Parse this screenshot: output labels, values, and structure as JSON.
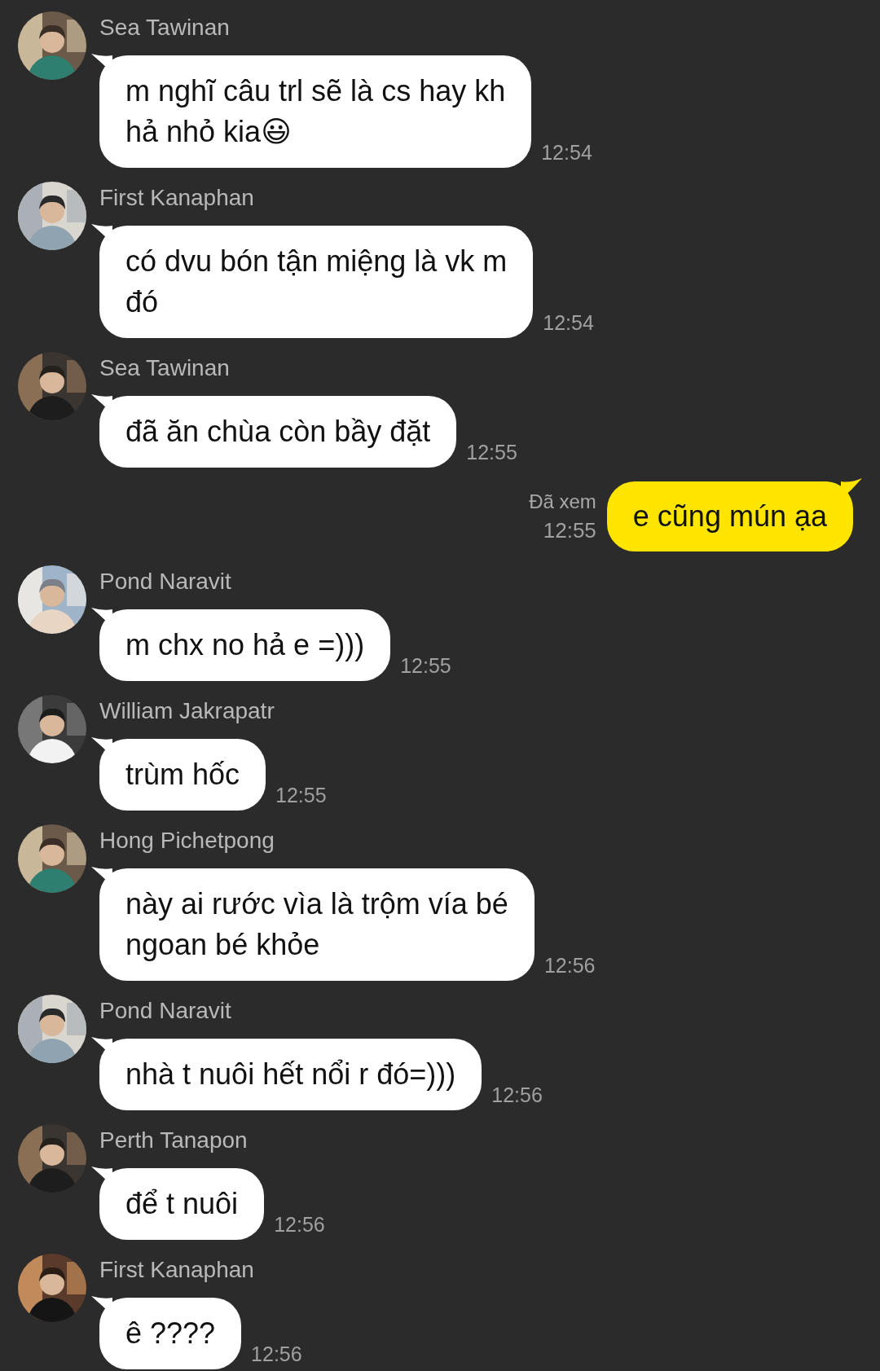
{
  "messages": [
    {
      "kind": "incoming",
      "sender": "Sea Tawinan",
      "text": "m nghĩ câu trl sẽ là cs hay kh\nhả nhỏ kia😃",
      "time": "12:54"
    },
    {
      "kind": "incoming",
      "sender": "First Kanaphan",
      "text": "có dvu bón tận miệng là vk m\nđó",
      "time": "12:54"
    },
    {
      "kind": "incoming",
      "sender": "Sea Tawinan",
      "text": "đã ăn chùa còn bầy đặt",
      "time": "12:55"
    },
    {
      "kind": "outgoing",
      "status": "Đã xem",
      "text": "e cũng mún ạa",
      "time": "12:55"
    },
    {
      "kind": "incoming",
      "sender": "Pond Naravit",
      "text": "m chx no hả e =)))",
      "time": "12:55"
    },
    {
      "kind": "incoming",
      "sender": "William Jakrapatr",
      "text": "trùm hốc",
      "time": "12:55"
    },
    {
      "kind": "incoming",
      "sender": "Hong Pichetpong",
      "text": "này ai rước vìa là trộm vía bé\nngoan bé khỏe",
      "time": "12:56"
    },
    {
      "kind": "incoming",
      "sender": "Pond Naravit",
      "text": "nhà t nuôi hết nổi r đó=)))",
      "time": "12:56"
    },
    {
      "kind": "incoming",
      "sender": "Perth Tanapon",
      "text": "để t nuôi",
      "time": "12:56"
    },
    {
      "kind": "incoming",
      "sender": "First Kanaphan",
      "text": "ê ????",
      "time": "12:56"
    }
  ]
}
